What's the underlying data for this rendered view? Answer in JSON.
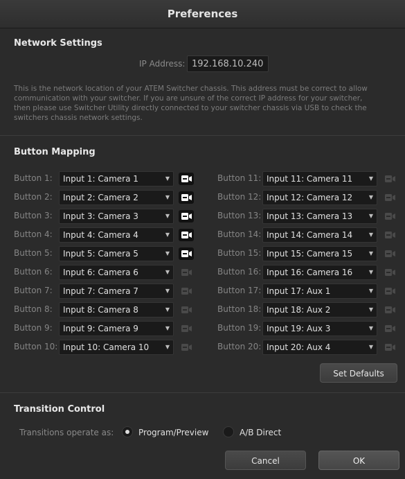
{
  "window": {
    "title": "Preferences"
  },
  "network": {
    "section_title": "Network Settings",
    "ip_label": "IP Address:",
    "ip_value": "192.168.10.240",
    "description": "This is the network location of your ATEM Switcher chassis. This address must be correct to allow communication with your switcher. If you are unsure of the correct IP address for your switcher, then please use Switcher Utility directly connected to your switcher chassis via USB to check the switchers chassis network settings."
  },
  "mapping": {
    "section_title": "Button Mapping",
    "left": [
      {
        "label": "Button 1:",
        "value": "Input 1: Camera 1",
        "cam_active": true
      },
      {
        "label": "Button 2:",
        "value": "Input 2: Camera 2",
        "cam_active": true
      },
      {
        "label": "Button 3:",
        "value": "Input 3: Camera 3",
        "cam_active": true
      },
      {
        "label": "Button 4:",
        "value": "Input 4: Camera 4",
        "cam_active": true
      },
      {
        "label": "Button 5:",
        "value": "Input 5: Camera 5",
        "cam_active": true
      },
      {
        "label": "Button 6:",
        "value": "Input 6: Camera 6",
        "cam_active": false
      },
      {
        "label": "Button 7:",
        "value": "Input 7: Camera 7",
        "cam_active": false
      },
      {
        "label": "Button 8:",
        "value": "Input 8: Camera 8",
        "cam_active": false
      },
      {
        "label": "Button 9:",
        "value": "Input 9: Camera 9",
        "cam_active": false
      },
      {
        "label": "Button 10:",
        "value": "Input 10: Camera 10",
        "cam_active": false
      }
    ],
    "right": [
      {
        "label": "Button 11:",
        "value": "Input 11: Camera 11",
        "cam_active": false
      },
      {
        "label": "Button 12:",
        "value": "Input 12: Camera 12",
        "cam_active": false
      },
      {
        "label": "Button 13:",
        "value": "Input 13: Camera 13",
        "cam_active": false
      },
      {
        "label": "Button 14:",
        "value": "Input 14: Camera 14",
        "cam_active": false
      },
      {
        "label": "Button 15:",
        "value": "Input 15: Camera 15",
        "cam_active": false
      },
      {
        "label": "Button 16:",
        "value": "Input 16: Camera 16",
        "cam_active": false
      },
      {
        "label": "Button 17:",
        "value": "Input 17: Aux 1",
        "cam_active": false
      },
      {
        "label": "Button 18:",
        "value": "Input 18: Aux 2",
        "cam_active": false
      },
      {
        "label": "Button 19:",
        "value": "Input 19: Aux 3",
        "cam_active": false
      },
      {
        "label": "Button 20:",
        "value": "Input 20: Aux 4",
        "cam_active": false
      }
    ],
    "set_defaults_label": "Set Defaults"
  },
  "transition": {
    "section_title": "Transition Control",
    "operate_label": "Transitions operate as:",
    "options": [
      {
        "label": "Program/Preview",
        "selected": true
      },
      {
        "label": "A/B Direct",
        "selected": false
      }
    ]
  },
  "footer": {
    "cancel_label": "Cancel",
    "ok_label": "OK"
  },
  "icons": {
    "dropdown": "chevron-down-icon",
    "camera": "camera-icon",
    "radio": "radio-icon"
  },
  "colors": {
    "background": "#2b2b2b",
    "field": "#1a1a1a",
    "camera_active": "#ffffff",
    "camera_inactive": "#4a4a4a"
  }
}
